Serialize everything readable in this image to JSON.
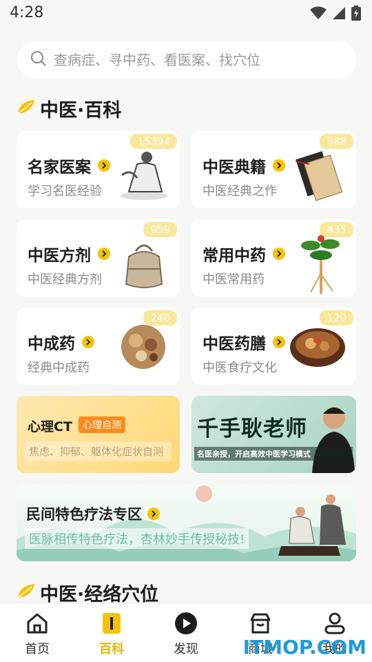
{
  "status_bar": {
    "time": "4:28"
  },
  "search": {
    "placeholder": "查病症、寻中药、看医案、找穴位"
  },
  "section_baike": {
    "title": "中医·百科"
  },
  "cards": [
    {
      "title": "名家医案",
      "subtitle": "学习名医经验",
      "count": "15394"
    },
    {
      "title": "中医典籍",
      "subtitle": "中医经典之作",
      "count": "588"
    },
    {
      "title": "中医方剂",
      "subtitle": "中医经典方剂",
      "count": "959"
    },
    {
      "title": "常用中药",
      "subtitle": "中医常用药",
      "count": "435"
    },
    {
      "title": "中成药",
      "subtitle": "经典中成药",
      "count": "240"
    },
    {
      "title": "中医药膳",
      "subtitle": "中医食疗文化",
      "count": "120"
    }
  ],
  "promos": {
    "psych_ct": {
      "title": "心理CT",
      "tag": "心理自测",
      "desc": "焦虑、抑郁、躯体化症状自测"
    },
    "teacher": {
      "title": "千手耿老师",
      "desc": "名医亲授，开启高效中医学习模式"
    },
    "folk": {
      "title": "民间特色疗法专区",
      "desc": "医脉相传特色疗法，杏林妙手传授秘技!"
    }
  },
  "section_meridian": {
    "title": "中医·经络穴位"
  },
  "bottom_nav": [
    {
      "label": "首页",
      "icon": "home-icon"
    },
    {
      "label": "百科",
      "icon": "book-icon"
    },
    {
      "label": "发现",
      "icon": "play-icon"
    },
    {
      "label": "商城",
      "icon": "store-icon"
    },
    {
      "label": "我的",
      "icon": "user-icon"
    }
  ],
  "watermark": "ITMOP.COM",
  "colors": {
    "accent": "#f5c400",
    "active_nav": "#e6b600",
    "badge": "#fbe79a",
    "watermark": "#1e9bd8"
  }
}
